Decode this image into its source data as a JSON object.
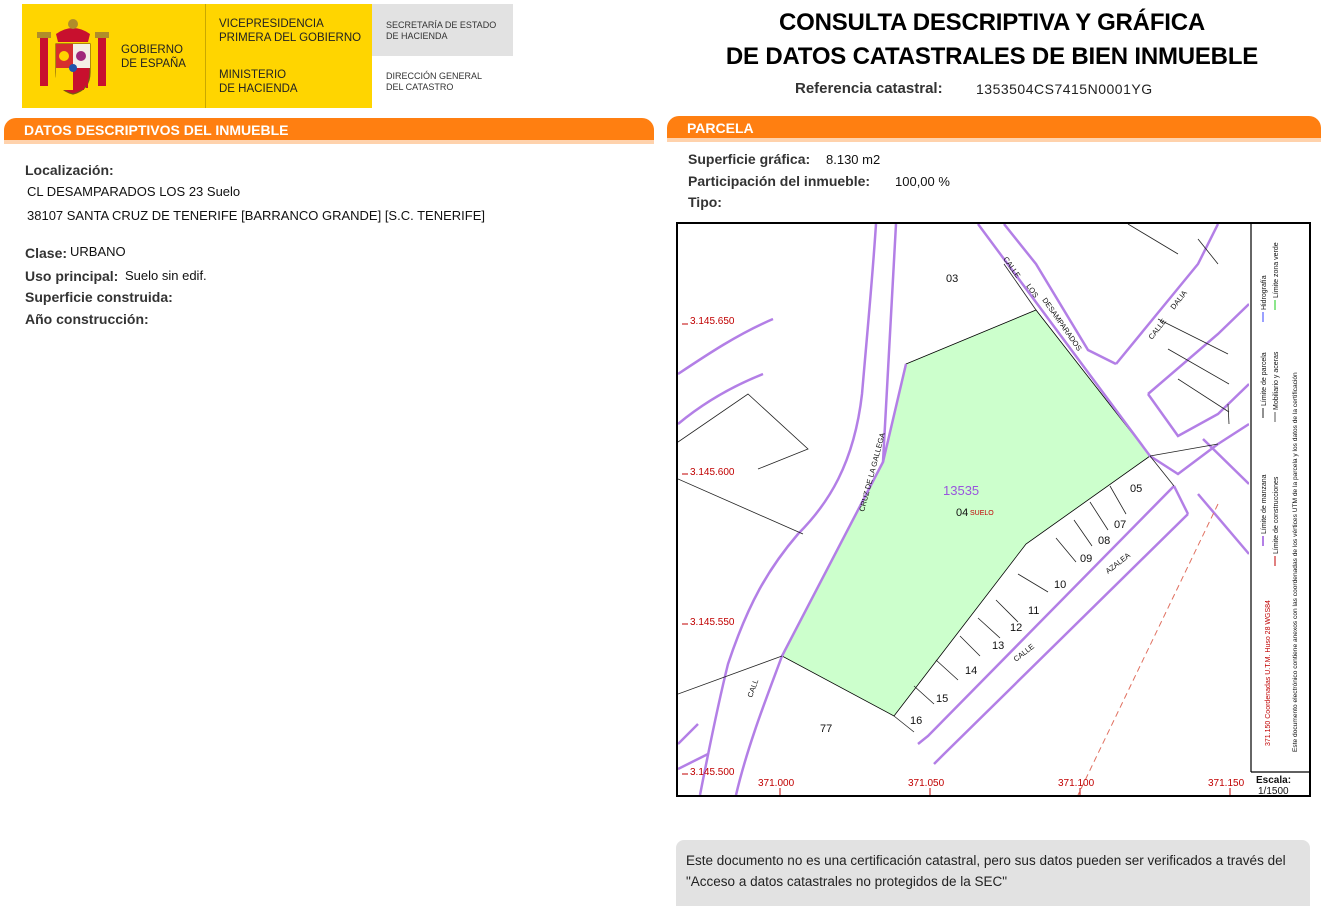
{
  "header": {
    "gov_logo_line1": "GOBIERNO",
    "gov_logo_line2": "DE ESPAÑA",
    "vicepresidencia_line1": "VICEPRESIDENCIA",
    "vicepresidencia_line2": "PRIMERA DEL GOBIERNO",
    "ministerio_line1": "MINISTERIO",
    "ministerio_line2": "DE HACIENDA",
    "secretaria_line1": "SECRETARÍA DE ESTADO",
    "secretaria_line2": "DE HACIENDA",
    "direccion_line1": "DIRECCIÓN GENERAL",
    "direccion_line2": "DEL CATASTRO",
    "title_line1": "CONSULTA DESCRIPTIVA Y GRÁFICA",
    "title_line2": "DE DATOS CATASTRALES DE BIEN INMUEBLE",
    "ref_label": "Referencia catastral:",
    "ref_value": "1353504CS7415N0001YG"
  },
  "descriptivos": {
    "section_title": "DATOS DESCRIPTIVOS DEL INMUEBLE",
    "localizacion_label": "Localización:",
    "localizacion_line1": "CL DESAMPARADOS LOS 23 Suelo",
    "localizacion_line2": "38107 SANTA CRUZ DE TENERIFE [BARRANCO GRANDE] [S.C. TENERIFE]",
    "clase_label": "Clase:",
    "clase_value": "URBANO",
    "uso_label": "Uso principal:",
    "uso_value": "Suelo sin edif.",
    "superficie_label": "Superficie construida:",
    "anio_label": "Año construcción:"
  },
  "parcela": {
    "section_title": "PARCELA",
    "superficie_label": "Superficie gráfica:",
    "superficie_value": "8.130 m2",
    "participacion_label": "Participación del inmueble:",
    "participacion_value": "100,00 %",
    "tipo_label": "Tipo:"
  },
  "map": {
    "parcel_color": "#ccffcc",
    "boundary_color": "#b37fe6",
    "coord_color": "#c00000",
    "y_coords": [
      "3.145.650",
      "3.145.600",
      "3.145.550",
      "3.145.500"
    ],
    "x_coords": [
      "371.000",
      "371.050",
      "371.100",
      "371.150"
    ],
    "parcel_number": "13535",
    "parcel_sub_code": "04",
    "parcel_sub_label": "SUELO",
    "block_numbers": [
      "03",
      "05",
      "07",
      "08",
      "09",
      "10",
      "11",
      "12",
      "13",
      "14",
      "15",
      "16",
      "77"
    ],
    "street_calle": "CALLE",
    "street_los": "LOS",
    "street_desamparados": "DESAMPARADOS",
    "street_dalia": "DALIA",
    "street_azalea": "AZALEA",
    "street_cruz": "CRUZ DE LA GALLEGA",
    "street_calle_short": "CALL",
    "legend_manzana": "Límite de manzana",
    "legend_parcela": "Límite de parcela",
    "legend_hidrografia": "Hidrografía",
    "legend_construcciones": "Límite de construcciones",
    "legend_mobiliario": "Mobiliario y aceras",
    "legend_zona_verde": "Límite zona verde",
    "legend_coords": "371.150 Coordenadas U.T.M. Huso 28 WGS84",
    "legend_note": "Este documento electrónico contiene anexos con las coordenadas de los vértices UTM de la parcela y los datos de la certificación",
    "scale_label": "Escala:",
    "scale_value": "1/1500"
  },
  "note": {
    "text": "Este documento no es una certificación catastral, pero sus datos pueden ser verificados a través del \"Acceso a datos catastrales no protegidos de la SEC\""
  }
}
